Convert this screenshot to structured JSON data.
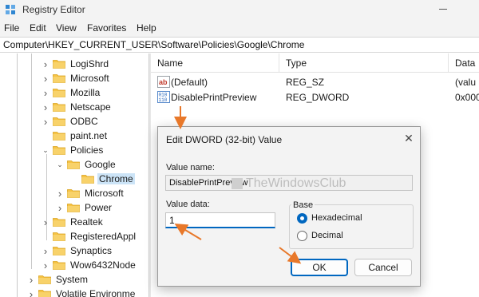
{
  "window": {
    "title": "Registry Editor"
  },
  "menu": [
    "File",
    "Edit",
    "View",
    "Favorites",
    "Help"
  ],
  "address": "Computer\\HKEY_CURRENT_USER\\Software\\Policies\\Google\\Chrome",
  "tree": [
    {
      "label": "LogiShrd",
      "expanded": false
    },
    {
      "label": "Microsoft",
      "expanded": false
    },
    {
      "label": "Mozilla",
      "expanded": false
    },
    {
      "label": "Netscape",
      "expanded": false
    },
    {
      "label": "ODBC",
      "expanded": false
    },
    {
      "label": "paint.net",
      "expanded": null
    },
    {
      "label": "Policies",
      "expanded": true
    },
    {
      "label": "Google",
      "expanded": true
    },
    {
      "label": "Chrome",
      "expanded": null,
      "selected": true
    },
    {
      "label": "Microsoft",
      "expanded": false
    },
    {
      "label": "Power",
      "expanded": false
    },
    {
      "label": "Realtek",
      "expanded": false
    },
    {
      "label": "RegisteredAppl",
      "expanded": null
    },
    {
      "label": "Synaptics",
      "expanded": false
    },
    {
      "label": "Wow6432Node",
      "expanded": false
    },
    {
      "label": "System",
      "expanded": false
    },
    {
      "label": "Volatile Environme",
      "expanded": false
    }
  ],
  "columns": {
    "name": "Name",
    "type": "Type",
    "data": "Data"
  },
  "values": [
    {
      "name": "(Default)",
      "type": "REG_SZ",
      "data": "(valu",
      "icon": "string-value-icon"
    },
    {
      "name": "DisablePrintPreview",
      "type": "REG_DWORD",
      "data": "0x000",
      "icon": "dword-value-icon"
    }
  ],
  "dialog": {
    "title": "Edit DWORD (32-bit) Value",
    "value_name_label": "Value name:",
    "value_name": "DisablePrintPreview",
    "value_data_label": "Value data:",
    "value_data": "1",
    "base_label": "Base",
    "hex_label": "Hexadecimal",
    "dec_label": "Decimal",
    "selected_base": "Hexadecimal",
    "ok_label": "OK",
    "cancel_label": "Cancel"
  },
  "watermark": "TheWindowsClub",
  "colors": {
    "accent": "#0067c0",
    "annotation_arrow": "#e8782a",
    "selection": "#cce4f7"
  }
}
